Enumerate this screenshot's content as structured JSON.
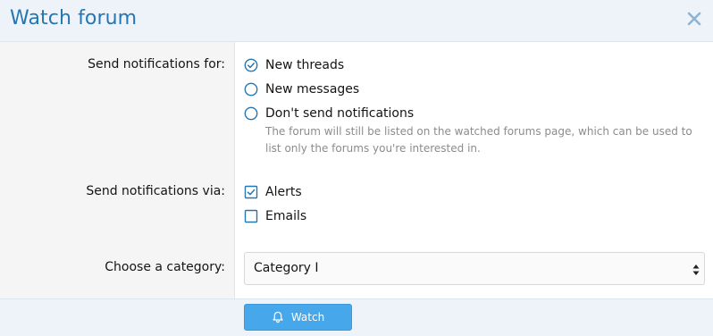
{
  "dialog": {
    "title": "Watch forum",
    "close_icon": "close-icon"
  },
  "notify_for": {
    "label": "Send notifications for:",
    "options": [
      {
        "label": "New threads",
        "selected": true
      },
      {
        "label": "New messages",
        "selected": false
      },
      {
        "label": "Don't send notifications",
        "selected": false
      }
    ],
    "hint": "The forum will still be listed on the watched forums page, which can be used to list only the forums you're interested in."
  },
  "notify_via": {
    "label": "Send notifications via:",
    "options": [
      {
        "label": "Alerts",
        "checked": true
      },
      {
        "label": "Emails",
        "checked": false
      }
    ]
  },
  "category": {
    "label": "Choose a category:",
    "value": "Category I"
  },
  "footer": {
    "watch_label": "Watch",
    "watch_icon": "bell-icon"
  },
  "colors": {
    "accent": "#2577b1",
    "button": "#47a7eb",
    "header_bg": "#eef3f9"
  }
}
